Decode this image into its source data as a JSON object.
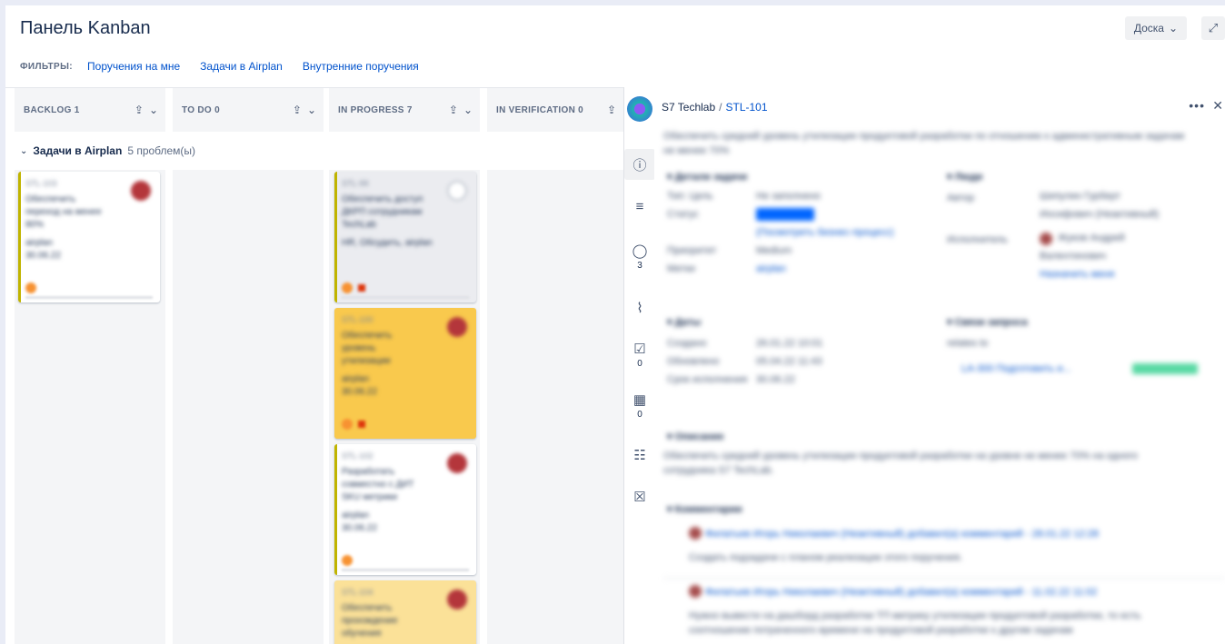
{
  "header": {
    "title": "Панель Kanban",
    "board_button": "Доска",
    "expand_icon": "expand-icon"
  },
  "filters": {
    "label": "ФИЛЬТРЫ:",
    "items": [
      "Поручения на мне",
      "Задачи в Airplan",
      "Внутренние поручения"
    ]
  },
  "columns": [
    {
      "title": "BACKLOG 1"
    },
    {
      "title": "TO DO 0"
    },
    {
      "title": "IN PROGRESS 7"
    },
    {
      "title": "IN VERIFICATION 0"
    }
  ],
  "swimlane": {
    "title": "Задачи в Airplan",
    "count": "5 проблем(ы)"
  },
  "rail": {
    "comments_count": "3",
    "checklist_count": "0",
    "table_count": "0"
  },
  "detail": {
    "project": "S7 Techlab",
    "separator": "/",
    "issue_key": "STL-101",
    "more": "•••",
    "close": "✕"
  },
  "colors": {
    "accent": "#0052cc",
    "yellow_card": "#f9c94d",
    "light_yellow_card": "#fbe198",
    "column_bg": "#f4f5f7"
  }
}
